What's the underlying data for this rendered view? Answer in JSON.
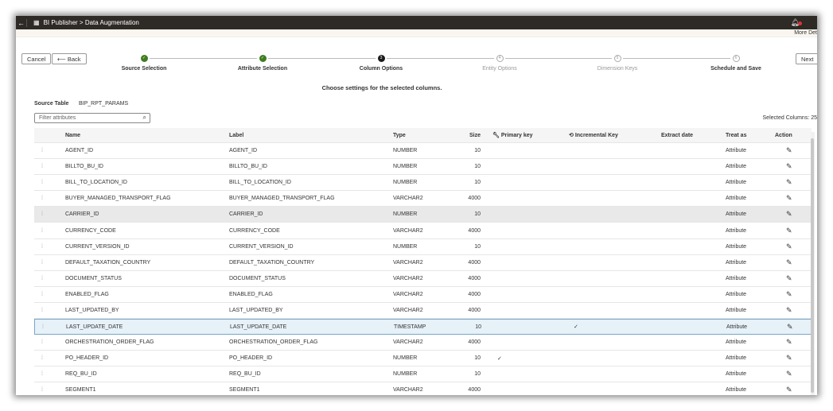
{
  "header": {
    "back": "←",
    "app_icon": "▦",
    "title": "BI Publisher > Data Augmentation",
    "more": "More Det"
  },
  "buttons": {
    "cancel": "Cancel",
    "back": "Back",
    "back_arrow": "⟵",
    "next": "Next"
  },
  "train": [
    {
      "label": "Source Selection",
      "state": "done",
      "num": "✓"
    },
    {
      "label": "Attribute Selection",
      "state": "done",
      "num": "✓"
    },
    {
      "label": "Column Options",
      "state": "current",
      "num": "3"
    },
    {
      "label": "Entity Options",
      "state": "todo",
      "num": "4"
    },
    {
      "label": "Dimension Keys",
      "state": "todo",
      "num": "5"
    },
    {
      "label": "Schedule and Save",
      "state": "todo",
      "num": "6"
    }
  ],
  "hint": "Choose settings for the selected columns.",
  "source_table_label": "Source Table",
  "source_table": "BIP_RPT_PARAMS",
  "filter_placeholder": "Filter attributes",
  "selected_columns": "Selected Columns: 25",
  "columns": {
    "name": "Name",
    "label": "Label",
    "type": "Type",
    "size": "Size",
    "pk": "Primary key",
    "ik": "Incremental Key",
    "ed": "Extract date",
    "ta": "Treat as",
    "action": "Action"
  },
  "rows": [
    {
      "name": "AGENT_ID",
      "label": "AGENT_ID",
      "type": "NUMBER",
      "size": "10",
      "pk": "",
      "ik": "",
      "treat": "Attribute"
    },
    {
      "name": "BILLTO_BU_ID",
      "label": "BILLTO_BU_ID",
      "type": "NUMBER",
      "size": "10",
      "pk": "",
      "ik": "",
      "treat": "Attribute"
    },
    {
      "name": "BILL_TO_LOCATION_ID",
      "label": "BILL_TO_LOCATION_ID",
      "type": "NUMBER",
      "size": "10",
      "pk": "",
      "ik": "",
      "treat": "Attribute"
    },
    {
      "name": "BUYER_MANAGED_TRANSPORT_FLAG",
      "label": "BUYER_MANAGED_TRANSPORT_FLAG",
      "type": "VARCHAR2",
      "size": "4000",
      "pk": "",
      "ik": "",
      "treat": "Attribute"
    },
    {
      "name": "CARRIER_ID",
      "label": "CARRIER_ID",
      "type": "NUMBER",
      "size": "10",
      "pk": "",
      "ik": "",
      "treat": "Attribute"
    },
    {
      "name": "CURRENCY_CODE",
      "label": "CURRENCY_CODE",
      "type": "VARCHAR2",
      "size": "4000",
      "pk": "",
      "ik": "",
      "treat": "Attribute"
    },
    {
      "name": "CURRENT_VERSION_ID",
      "label": "CURRENT_VERSION_ID",
      "type": "NUMBER",
      "size": "10",
      "pk": "",
      "ik": "",
      "treat": "Attribute"
    },
    {
      "name": "DEFAULT_TAXATION_COUNTRY",
      "label": "DEFAULT_TAXATION_COUNTRY",
      "type": "VARCHAR2",
      "size": "4000",
      "pk": "",
      "ik": "",
      "treat": "Attribute"
    },
    {
      "name": "DOCUMENT_STATUS",
      "label": "DOCUMENT_STATUS",
      "type": "VARCHAR2",
      "size": "4000",
      "pk": "",
      "ik": "",
      "treat": "Attribute"
    },
    {
      "name": "ENABLED_FLAG",
      "label": "ENABLED_FLAG",
      "type": "VARCHAR2",
      "size": "4000",
      "pk": "",
      "ik": "",
      "treat": "Attribute"
    },
    {
      "name": "LAST_UPDATED_BY",
      "label": "LAST_UPDATED_BY",
      "type": "VARCHAR2",
      "size": "4000",
      "pk": "",
      "ik": "",
      "treat": "Attribute"
    },
    {
      "name": "LAST_UPDATE_DATE",
      "label": "LAST_UPDATE_DATE",
      "type": "TIMESTAMP",
      "size": "10",
      "pk": "",
      "ik": "✓",
      "treat": "Attribute"
    },
    {
      "name": "ORCHESTRATION_ORDER_FLAG",
      "label": "ORCHESTRATION_ORDER_FLAG",
      "type": "VARCHAR2",
      "size": "4000",
      "pk": "",
      "ik": "",
      "treat": "Attribute"
    },
    {
      "name": "PO_HEADER_ID",
      "label": "PO_HEADER_ID",
      "type": "NUMBER",
      "size": "10",
      "pk": "✓",
      "ik": "",
      "treat": "Attribute"
    },
    {
      "name": "REQ_BU_ID",
      "label": "REQ_BU_ID",
      "type": "NUMBER",
      "size": "10",
      "pk": "",
      "ik": "",
      "treat": "Attribute"
    },
    {
      "name": "SEGMENT1",
      "label": "SEGMENT1",
      "type": "VARCHAR2",
      "size": "4000",
      "pk": "",
      "ik": "",
      "treat": "Attribute"
    }
  ]
}
